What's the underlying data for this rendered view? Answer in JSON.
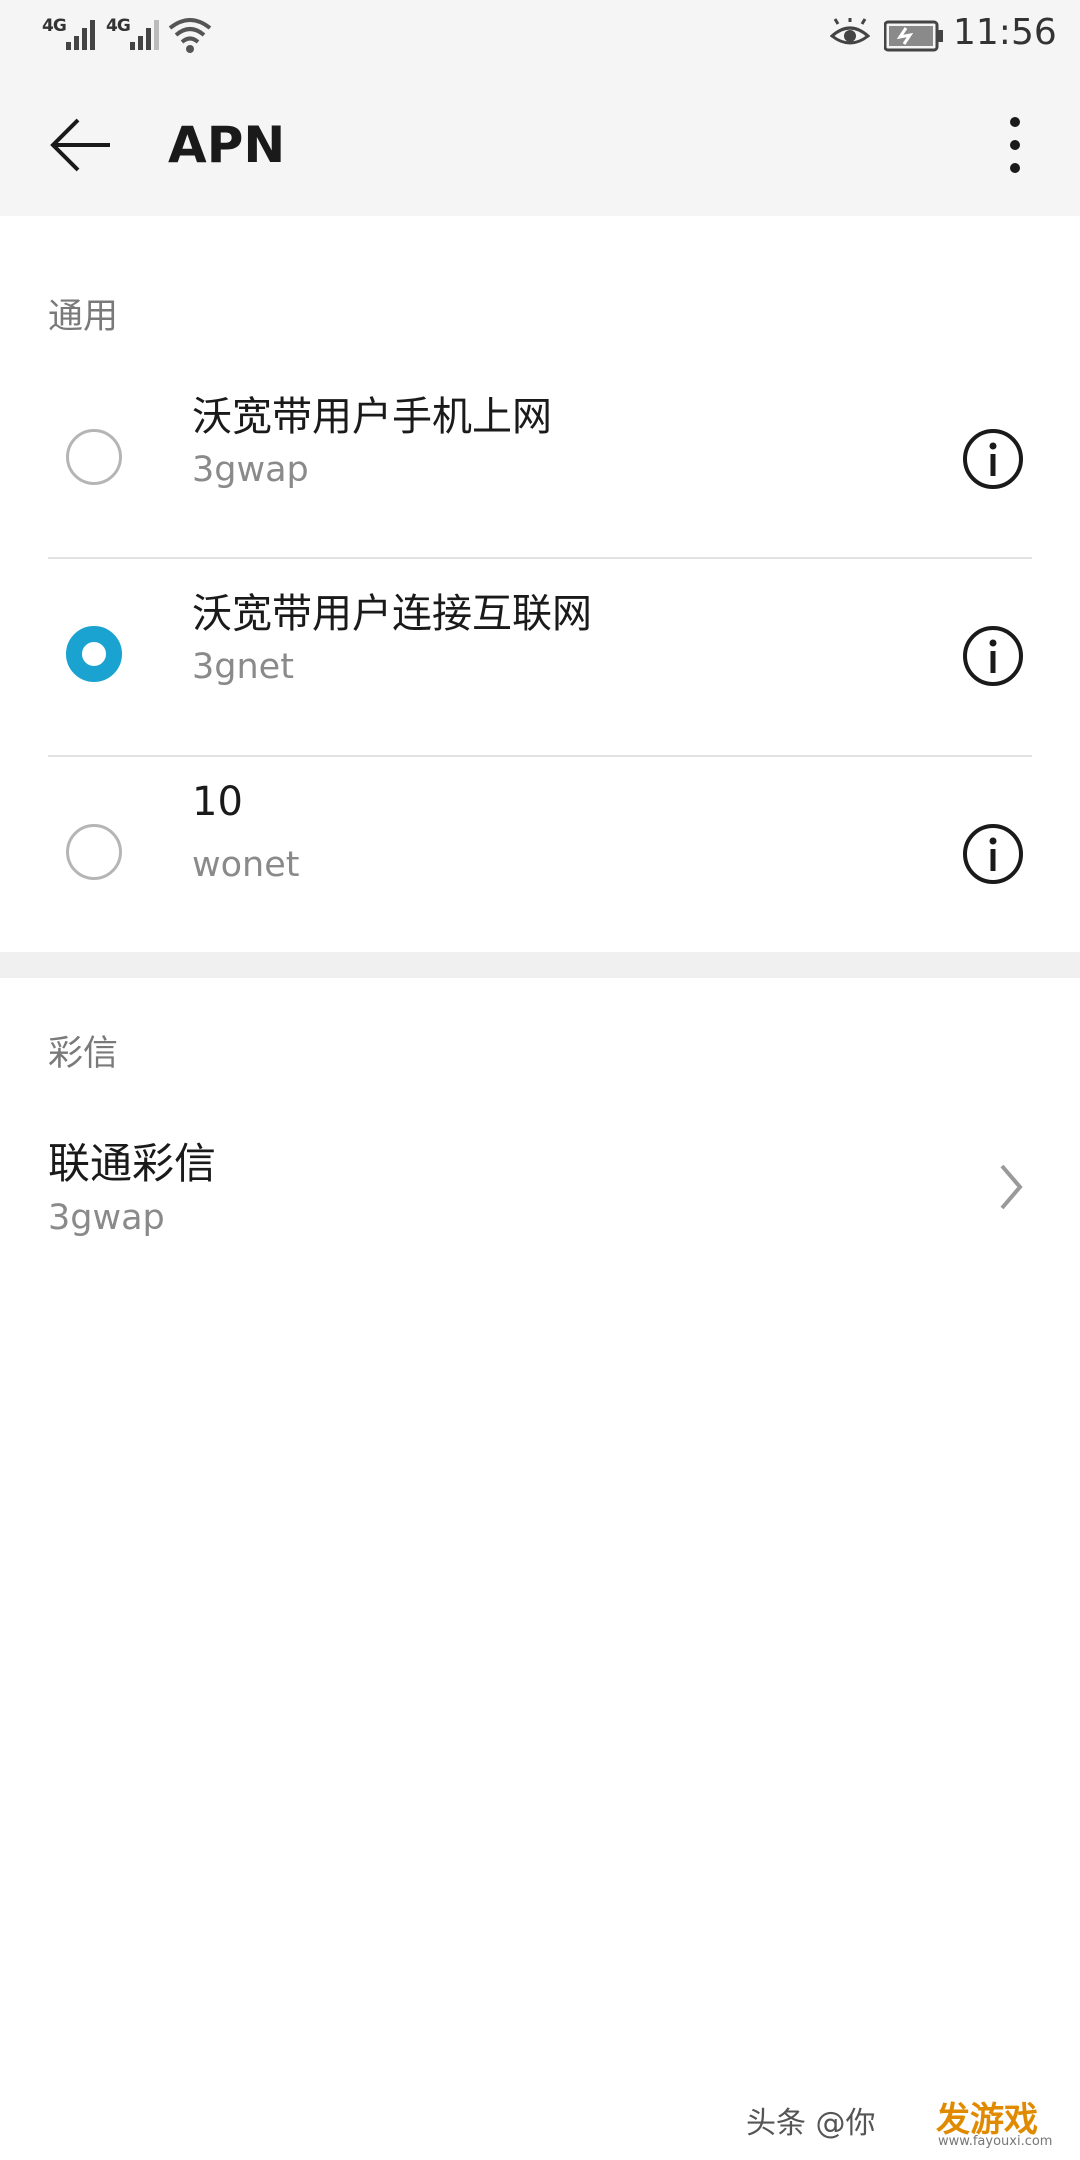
{
  "status_bar": {
    "network_1": "4G",
    "network_2": "4G",
    "time": "11:56"
  },
  "app_bar": {
    "title": "APN",
    "back_icon": "arrow-left-icon",
    "more_icon": "more-vertical-icon"
  },
  "sections": {
    "general": {
      "title": "通用",
      "items": [
        {
          "name": "沃宽带用户手机上网",
          "apn": "3gwap",
          "selected": false
        },
        {
          "name": "沃宽带用户连接互联网",
          "apn": "3gnet",
          "selected": true
        },
        {
          "name": "10",
          "apn": "wonet",
          "selected": false
        }
      ]
    },
    "mms": {
      "title": "彩信",
      "item": {
        "name": "联通彩信",
        "apn": "3gwap"
      }
    }
  },
  "watermark": {
    "text": "头条 @你",
    "logo": "发游戏",
    "url": "www.fayouxi.com"
  },
  "colors": {
    "accent": "#1aa3d1",
    "bar_background": "#f5f5f5",
    "secondary_text": "#8a8a8a"
  }
}
